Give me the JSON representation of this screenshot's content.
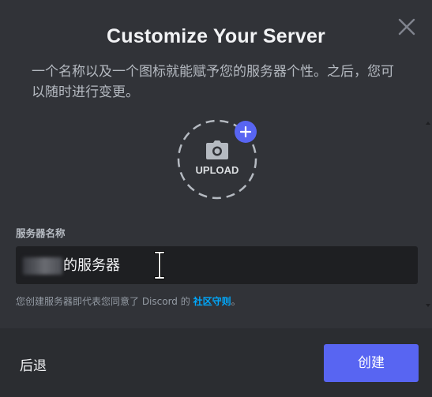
{
  "modal": {
    "title": "Customize Your Server",
    "subtitle": "一个名称以及一个图标就能赋予您的服务器个性。之后，您可以随时进行变更。"
  },
  "upload": {
    "label": "UPLOAD",
    "icon": "camera-icon",
    "badge_icon": "plus-icon"
  },
  "form": {
    "server_name_label": "服务器名称",
    "server_name_value": "的服务器",
    "terms_prefix": "您创建服务器即代表您同意了 Discord 的 ",
    "terms_link": "社区守则",
    "terms_suffix": "。"
  },
  "footer": {
    "back_label": "后退",
    "create_label": "创建"
  },
  "colors": {
    "background": "#313338",
    "footer": "#2b2d31",
    "input": "#1e1f22",
    "accent": "#5865f2",
    "link": "#00a8fc"
  }
}
